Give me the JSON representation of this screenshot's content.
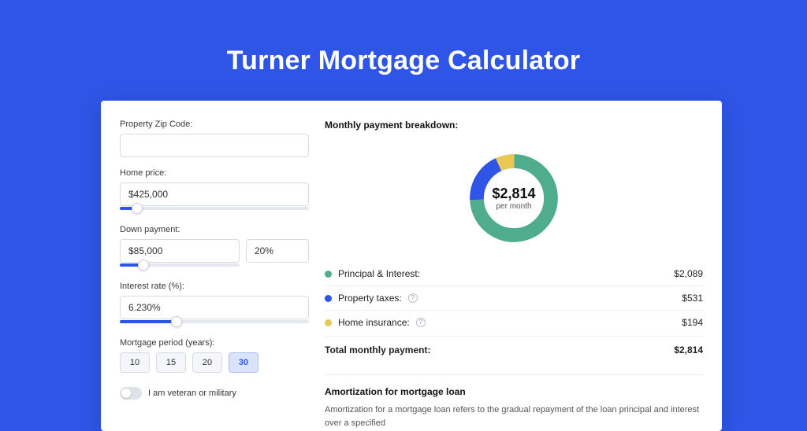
{
  "title": "Turner Mortgage Calculator",
  "form": {
    "zip": {
      "label": "Property Zip Code:",
      "value": ""
    },
    "home_price": {
      "label": "Home price:",
      "value": "$425,000",
      "slider_pct": 9
    },
    "down_payment": {
      "label": "Down payment:",
      "amount": "$85,000",
      "percent": "20%",
      "slider_pct": 20
    },
    "interest_rate": {
      "label": "Interest rate (%):",
      "value": "6.230%",
      "slider_pct": 30
    },
    "period": {
      "label": "Mortgage period (years):",
      "options": [
        "10",
        "15",
        "20",
        "30"
      ],
      "active_index": 3
    },
    "veteran": {
      "label": "I am veteran or military",
      "checked": false
    }
  },
  "breakdown": {
    "title": "Monthly payment breakdown:",
    "center_value": "$2,814",
    "center_sub": "per month",
    "items": [
      {
        "label": "Principal & Interest:",
        "value": "$2,089",
        "color": "green",
        "info": false
      },
      {
        "label": "Property taxes:",
        "value": "$531",
        "color": "blue",
        "info": true
      },
      {
        "label": "Home insurance:",
        "value": "$194",
        "color": "yellow",
        "info": true
      }
    ],
    "total_label": "Total monthly payment:",
    "total_value": "$2,814"
  },
  "amortization": {
    "title": "Amortization for mortgage loan",
    "body": "Amortization for a mortgage loan refers to the gradual repayment of the loan principal and interest over a specified"
  },
  "chart_data": {
    "type": "pie",
    "title": "Monthly payment breakdown",
    "series": [
      {
        "name": "Principal & Interest",
        "value": 2089,
        "color": "#4fac8d"
      },
      {
        "name": "Property taxes",
        "value": 531,
        "color": "#2f55e6"
      },
      {
        "name": "Home insurance",
        "value": 194,
        "color": "#e9c856"
      }
    ],
    "total": 2814,
    "center_label": "$2,814 per month"
  }
}
